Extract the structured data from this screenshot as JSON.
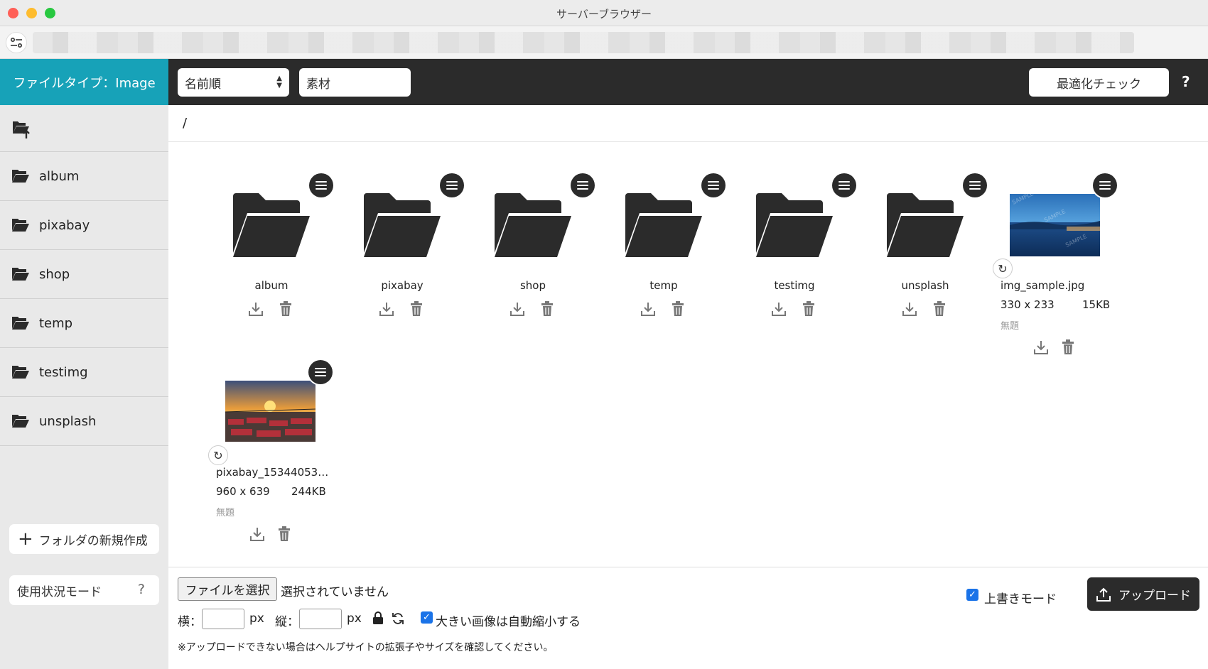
{
  "window": {
    "title": "サーバーブラウザー"
  },
  "toolbar": {
    "filetype_label": "ファイルタイプ：Image",
    "sort_value": "名前順",
    "search_value": "素材",
    "optimize_label": "最適化チェック",
    "help_label": "?"
  },
  "sidebar": {
    "items": [
      {
        "label": "album"
      },
      {
        "label": "pixabay"
      },
      {
        "label": "shop"
      },
      {
        "label": "temp"
      },
      {
        "label": "testimg"
      },
      {
        "label": "unsplash"
      }
    ],
    "new_folder_label": "フォルダの新規作成",
    "usage_label": "使用状況モード",
    "usage_help": "?"
  },
  "main": {
    "breadcrumb": "/",
    "folders": [
      {
        "name": "album"
      },
      {
        "name": "pixabay"
      },
      {
        "name": "shop"
      },
      {
        "name": "temp"
      },
      {
        "name": "testimg"
      },
      {
        "name": "unsplash"
      }
    ],
    "images": [
      {
        "name": "img_sample.jpg",
        "dimensions": "330 x 233",
        "size": "15KB",
        "title": "無題"
      },
      {
        "name": "pixabay_15344053…",
        "dimensions": "960 x 639",
        "size": "244KB",
        "title": "無題"
      }
    ]
  },
  "upload": {
    "choose_label": "ファイルを選択",
    "no_file_text": "選択されていません",
    "width_label": "横：",
    "height_label": "縦：",
    "unit": "px",
    "auto_resize_label": "大きい画像は自動縮小する",
    "auto_resize_checked": true,
    "overwrite_label": "上書きモード",
    "overwrite_checked": true,
    "upload_label": "アップロード",
    "note": "※アップロードできない場合はヘルプサイトの拡張子やサイズを確認してください。"
  },
  "colors": {
    "accent": "#17a2b8",
    "toolbar": "#2b2b2b",
    "sidebar": "#e9e9e9",
    "checkbox": "#1a73e8"
  }
}
